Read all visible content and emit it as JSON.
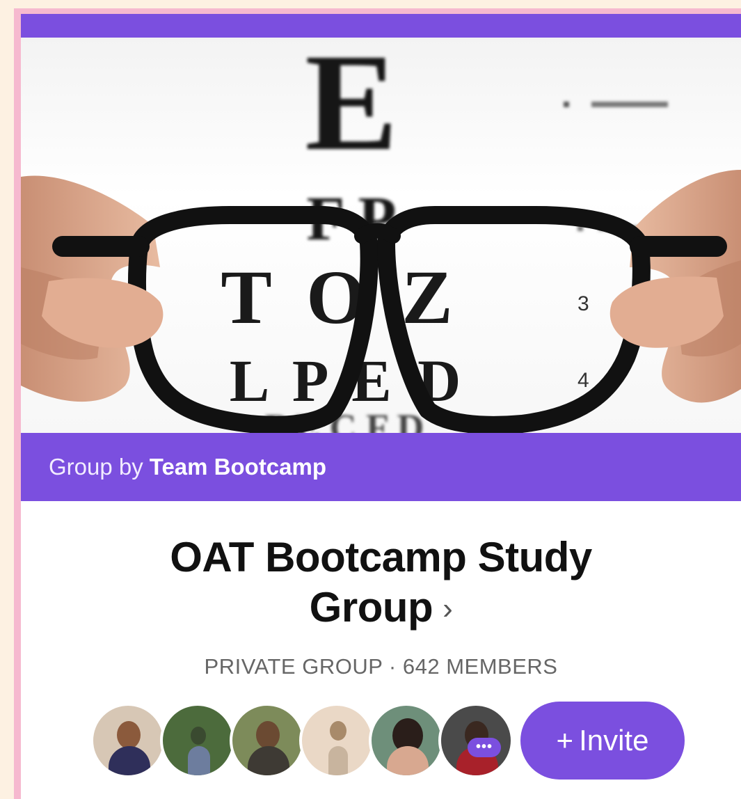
{
  "colors": {
    "accent": "#7b4fdf",
    "page_bg": "#fdf1e2",
    "frame_border": "#f6b9cf"
  },
  "cover": {
    "chart_letters": {
      "row1": "E",
      "row2": "F P",
      "row3": "T O Z",
      "row4": "L P E D",
      "row5": "P E C F D"
    },
    "line_numbers": {
      "row3": "3",
      "row4": "4"
    }
  },
  "group": {
    "owner_prefix": "Group by",
    "owner_name": "Team Bootcamp",
    "title_line1": "OAT Bootcamp Study",
    "title_line2": "Group",
    "chevron": "›",
    "meta": "PRIVATE GROUP · 642 MEMBERS"
  },
  "members": {
    "avatars": [
      {
        "icon": "member-avatar"
      },
      {
        "icon": "member-avatar"
      },
      {
        "icon": "member-avatar"
      },
      {
        "icon": "member-avatar"
      },
      {
        "icon": "member-avatar"
      },
      {
        "icon": "member-avatar-more"
      }
    ],
    "more_label": "•••"
  },
  "invite": {
    "icon": "plus-icon",
    "plus": "+",
    "label": "Invite"
  }
}
